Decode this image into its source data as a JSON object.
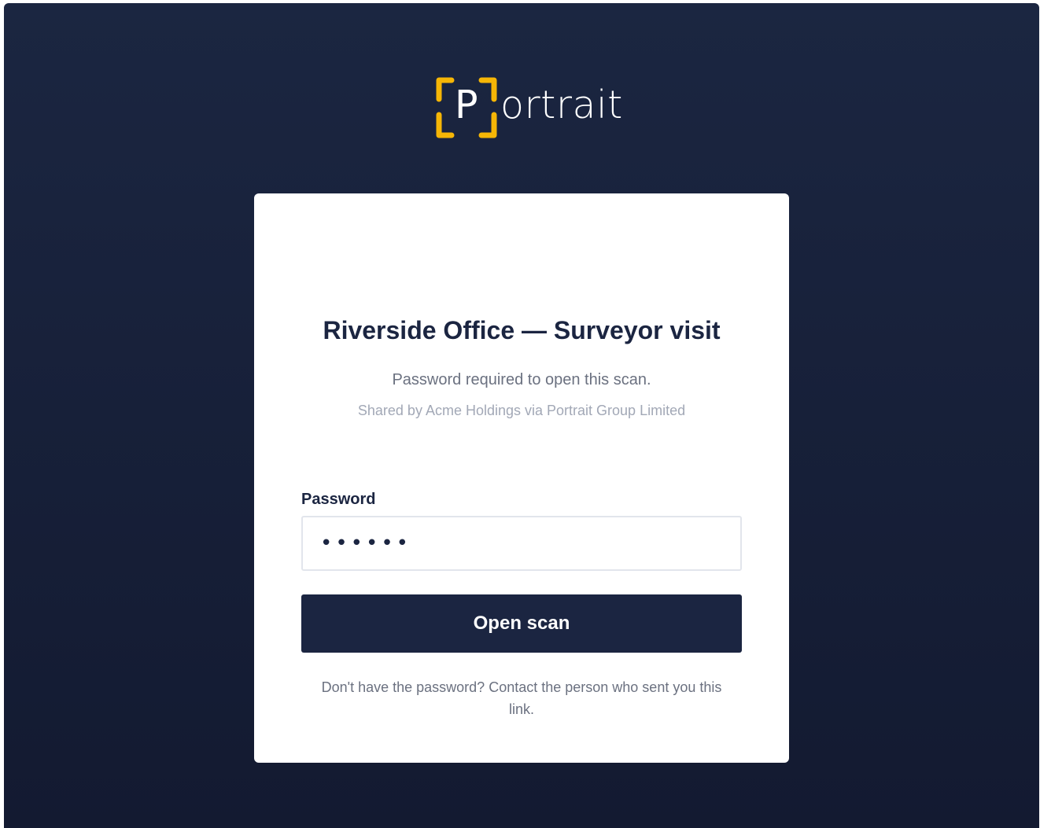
{
  "brand": {
    "logo_letter": "P",
    "logo_word": "ortrait",
    "accent_color": "#f6b606",
    "background_color": "#1b2641"
  },
  "card": {
    "title": "Riverside Office — Surveyor visit",
    "subtitle": "Password required to open this scan.",
    "shared_by": "Shared by Acme Holdings via Portrait Group Limited",
    "password_label": "Password",
    "password_value": "••••••",
    "submit_label": "Open scan",
    "help_text": "Don't have the password? Contact the person who sent you this link."
  }
}
